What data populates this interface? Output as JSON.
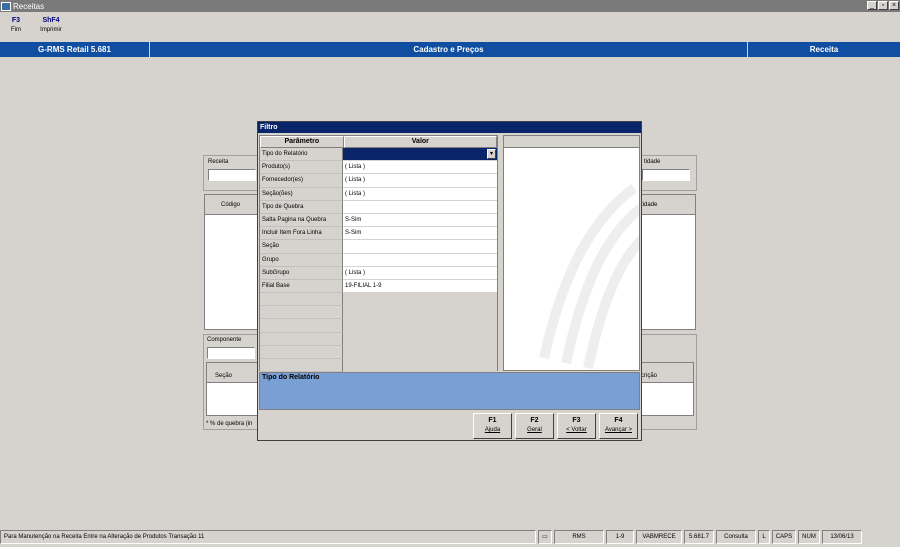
{
  "window": {
    "title": "Receitas"
  },
  "toolbar": [
    {
      "key": "F3",
      "label": "Fim"
    },
    {
      "key": "ShF4",
      "label": "Imprimir"
    }
  ],
  "header": {
    "app": "G-RMS Retail 5.681",
    "module": "Cadastro e Preços",
    "screen": "Receita"
  },
  "form": {
    "receita_label": "Receita",
    "quantidade_label": "tidade",
    "codigo_header": "Código",
    "quantidade_header": "tidade",
    "componente_label": "Componente",
    "secao_header": "Seção",
    "descricao_header": "crição",
    "quebra_note": "* % de quebra (in"
  },
  "dialog": {
    "title": "Filtro",
    "col_param": "Parâmetro",
    "col_value": "Valor",
    "params": [
      {
        "name": "Tipo do Relatório",
        "value": ""
      },
      {
        "name": "Produto(s)",
        "value": "( Lista )"
      },
      {
        "name": "Fornecedor(es)",
        "value": "( Lista )"
      },
      {
        "name": "Seção(ões)",
        "value": "( Lista )"
      },
      {
        "name": "Tipo de Quebra",
        "value": ""
      },
      {
        "name": "Salta Pagina na Quebra",
        "value": "S-Sim"
      },
      {
        "name": "Incluir Item Fora Linha",
        "value": "S-Sim"
      },
      {
        "name": "Seção",
        "value": ""
      },
      {
        "name": "Grupo",
        "value": ""
      },
      {
        "name": "SubGrupo",
        "value": "( Lista )"
      },
      {
        "name": "Filial Base",
        "value": "19-FILIAL 1-9"
      }
    ],
    "description_title": "Tipo do Relatório",
    "buttons": [
      {
        "key": "F1",
        "label": "Ajuda"
      },
      {
        "key": "F2",
        "label": "Geral"
      },
      {
        "key": "F3",
        "label": "< Voltar"
      },
      {
        "key": "F4",
        "label": "Avançar >"
      }
    ]
  },
  "statusbar": {
    "message": "Para Manutenção na Receita Entre na Alteração de Produtos Transação 11",
    "system": "RMS",
    "range": "1-9",
    "program": "VABMRECE",
    "version": "5.681.7",
    "mode": "Consulta",
    "l": "L",
    "caps": "CAPS",
    "num": "NUM",
    "date": "13/06/13"
  }
}
